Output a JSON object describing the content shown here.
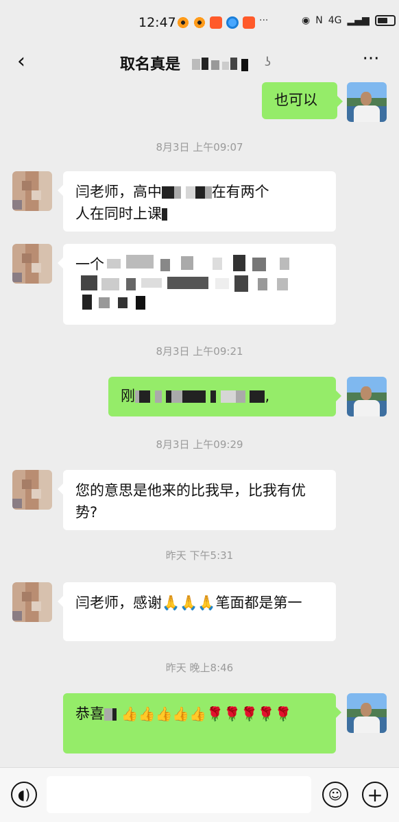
{
  "status_bar": {
    "time": "12:47",
    "network": "4G"
  },
  "nav": {
    "title": "取名真是",
    "back_icon": "chevron-left-icon",
    "more_icon": "more-icon"
  },
  "messages": [
    {
      "side": "me",
      "text": "也可以"
    },
    {
      "type": "time",
      "text": "8月3日 上午09:07"
    },
    {
      "side": "them",
      "text_a": "闫老师，高中",
      "text_b": "在有两个",
      "text_c": "人在同时上课"
    },
    {
      "side": "them",
      "text": "一个"
    },
    {
      "type": "time",
      "text": "8月3日 上午09:21"
    },
    {
      "side": "me",
      "text": "刚"
    },
    {
      "type": "time",
      "text": "8月3日 上午09:29"
    },
    {
      "side": "them",
      "text": "您的意思是他来的比我早，比我有优势?"
    },
    {
      "type": "time",
      "text": "昨天 下午5:31"
    },
    {
      "side": "them",
      "text": "闫老师，感谢🙏🙏🙏笔面都是第一"
    },
    {
      "type": "time",
      "text": "昨天 晚上8:46"
    },
    {
      "side": "me",
      "text": "恭喜",
      "emojis": "👍👍👍👍👍🌹🌹🌹🌹🌹"
    }
  ],
  "input": {
    "placeholder": ""
  },
  "icons": {
    "voice": "voice-icon",
    "emoji": "emoji-icon",
    "plus": "plus-icon"
  },
  "colors": {
    "background": "#ededed",
    "my_bubble": "#95ec69",
    "their_bubble": "#ffffff",
    "timestamp": "#9a9a9a"
  }
}
